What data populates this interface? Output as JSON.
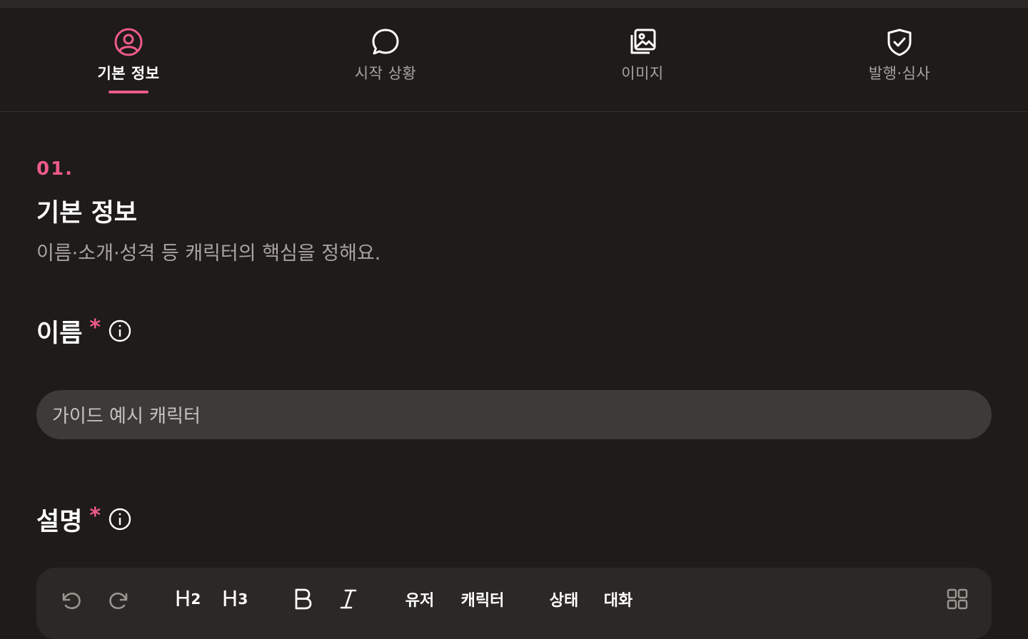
{
  "tabs": [
    {
      "label": "기본 정보",
      "icon": "user-circle-icon",
      "active": true
    },
    {
      "label": "시작 상황",
      "icon": "chat-bubble-icon",
      "active": false
    },
    {
      "label": "이미지",
      "icon": "image-gallery-icon",
      "active": false
    },
    {
      "label": "발행·심사",
      "icon": "shield-check-icon",
      "active": false
    }
  ],
  "section": {
    "number": "01.",
    "title": "기본 정보",
    "description": "이름·소개·성격 등 캐릭터의 핵심을 정해요."
  },
  "fields": {
    "name": {
      "label": "이름",
      "required_mark": "*",
      "value": "가이드 예시 캐릭터"
    },
    "description": {
      "label": "설명",
      "required_mark": "*"
    }
  },
  "toolbar": {
    "h2": "H",
    "h2_sub": "2",
    "h3": "H",
    "h3_sub": "3",
    "user": "유저",
    "character": "캐릭터",
    "status": "상태",
    "dialogue": "대화"
  },
  "colors": {
    "accent": "#ef5a8a",
    "background": "#1e1b19",
    "input_bg": "#3d3a38"
  }
}
